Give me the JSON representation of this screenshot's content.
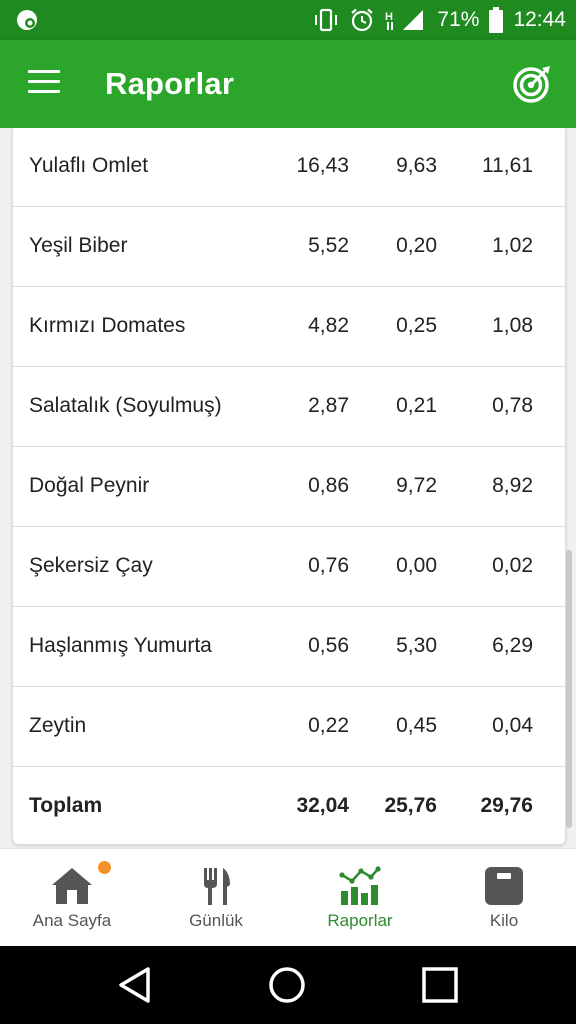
{
  "status_bar": {
    "battery": "71%",
    "time": "12:44"
  },
  "app_bar": {
    "title": "Raporlar"
  },
  "table": {
    "rows": [
      {
        "name": "Yulaflı Omlet",
        "v1": "16,43",
        "v2": "9,63",
        "v3": "11,61"
      },
      {
        "name": "Yeşil Biber",
        "v1": "5,52",
        "v2": "0,20",
        "v3": "1,02"
      },
      {
        "name": "Kırmızı Domates",
        "v1": "4,82",
        "v2": "0,25",
        "v3": "1,08"
      },
      {
        "name": "Salatalık (Soyulmuş)",
        "v1": "2,87",
        "v2": "0,21",
        "v3": "0,78"
      },
      {
        "name": "Doğal Peynir",
        "v1": "0,86",
        "v2": "9,72",
        "v3": "8,92"
      },
      {
        "name": "Şekersiz Çay",
        "v1": "0,76",
        "v2": "0,00",
        "v3": "0,02"
      },
      {
        "name": "Haşlanmış Yumurta",
        "v1": "0,56",
        "v2": "5,30",
        "v3": "6,29"
      },
      {
        "name": "Zeytin",
        "v1": "0,22",
        "v2": "0,45",
        "v3": "0,04"
      }
    ],
    "total": {
      "name": "Toplam",
      "v1": "32,04",
      "v2": "25,76",
      "v3": "29,76"
    }
  },
  "bottom_nav": [
    {
      "label": "Ana Sayfa",
      "icon": "home-icon"
    },
    {
      "label": "Günlük",
      "icon": "fork-knife-icon"
    },
    {
      "label": "Raporlar",
      "icon": "report-chart-icon",
      "active": true
    },
    {
      "label": "Kilo",
      "icon": "scale-icon"
    }
  ],
  "colors": {
    "status_bar": "#1f8a20",
    "app_bar": "#2ca52b",
    "active_nav": "#2e8b2e",
    "notification_dot": "#f39229"
  }
}
